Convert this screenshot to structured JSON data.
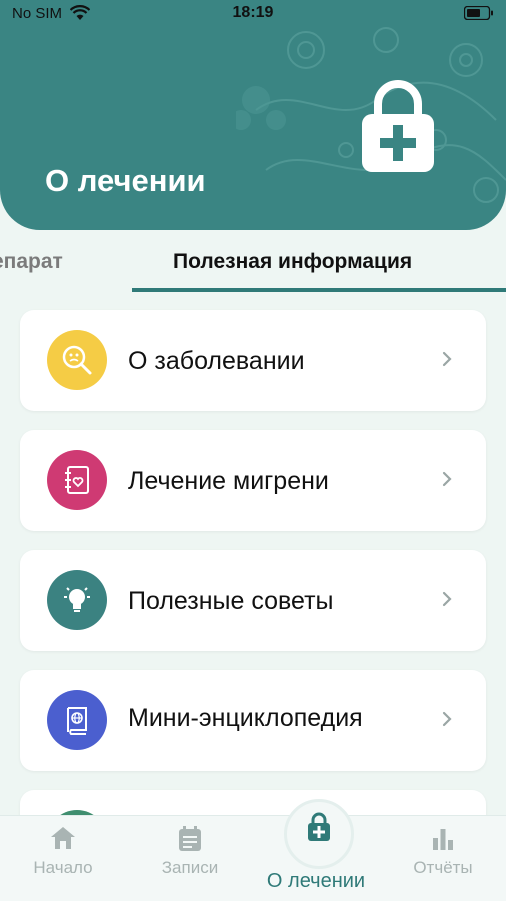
{
  "status_bar": {
    "carrier": "No SIM",
    "time": "18:19"
  },
  "header": {
    "title": "О лечении"
  },
  "tabs": [
    {
      "label": "епарат",
      "active": false
    },
    {
      "label": "Полезная информация",
      "active": true
    }
  ],
  "menu": [
    {
      "label": "О заболевании",
      "icon": "disease-search-icon",
      "color": "#f5cc45"
    },
    {
      "label": "Лечение мигрени",
      "icon": "notebook-heart-icon",
      "color": "#cf3a73"
    },
    {
      "label": "Полезные советы",
      "icon": "lightbulb-icon",
      "color": "#3b8281"
    },
    {
      "label": "Мини-энциклопедия",
      "icon": "encyclopedia-book-icon",
      "color": "#4b5fcf"
    }
  ],
  "bottom_nav": {
    "home": "Начало",
    "records": "Записи",
    "treatment": "О лечении",
    "reports": "Отчёты",
    "active": "treatment"
  },
  "colors": {
    "header": "#3a8583",
    "accent": "#2f7a78",
    "background": "#eef6f3"
  }
}
